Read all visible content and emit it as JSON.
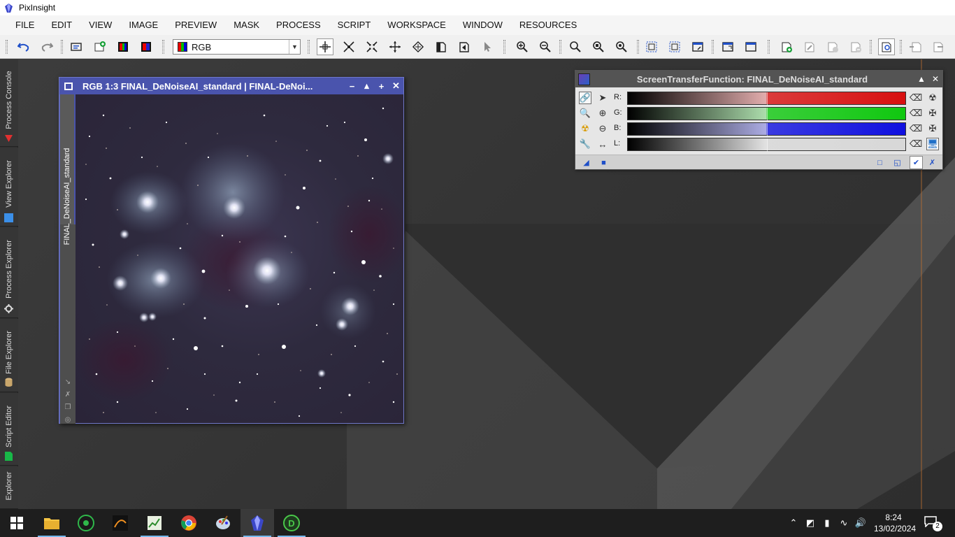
{
  "window": {
    "title": "PixInsight"
  },
  "menu": [
    "FILE",
    "EDIT",
    "VIEW",
    "IMAGE",
    "PREVIEW",
    "MASK",
    "PROCESS",
    "SCRIPT",
    "WORKSPACE",
    "WINDOW",
    "RESOURCES"
  ],
  "toolbar": {
    "channel_select": "RGB"
  },
  "side_dock": {
    "tabs": [
      "Process Console",
      "View Explorer",
      "Process Explorer",
      "File Explorer",
      "Script Editor",
      "Explorer"
    ]
  },
  "image_window": {
    "title": "RGB 1:3 FINAL_DeNoiseAI_standard | FINAL-DeNoi...",
    "view_tab": "FINAL_DeNoiseAI_standard",
    "controls": [
      "−",
      "▴",
      "+",
      "✕"
    ]
  },
  "stf_panel": {
    "title": "ScreenTransferFunction: FINAL_DeNoiseAI_standard",
    "channels": [
      {
        "label": "R:",
        "color": "#d81010"
      },
      {
        "label": "G:",
        "color": "#10c810"
      },
      {
        "label": "B:",
        "color": "#1010e0"
      },
      {
        "label": "L:",
        "color": "#d8d8d8"
      }
    ],
    "midtones": 0.5
  },
  "taskbar": {
    "time": "8:24",
    "date": "13/02/2024",
    "notification_count": "2"
  },
  "colors": {
    "image_window_title": "#4a54ad",
    "workspace": "#393939",
    "accent_tray": "#76b9ed"
  }
}
